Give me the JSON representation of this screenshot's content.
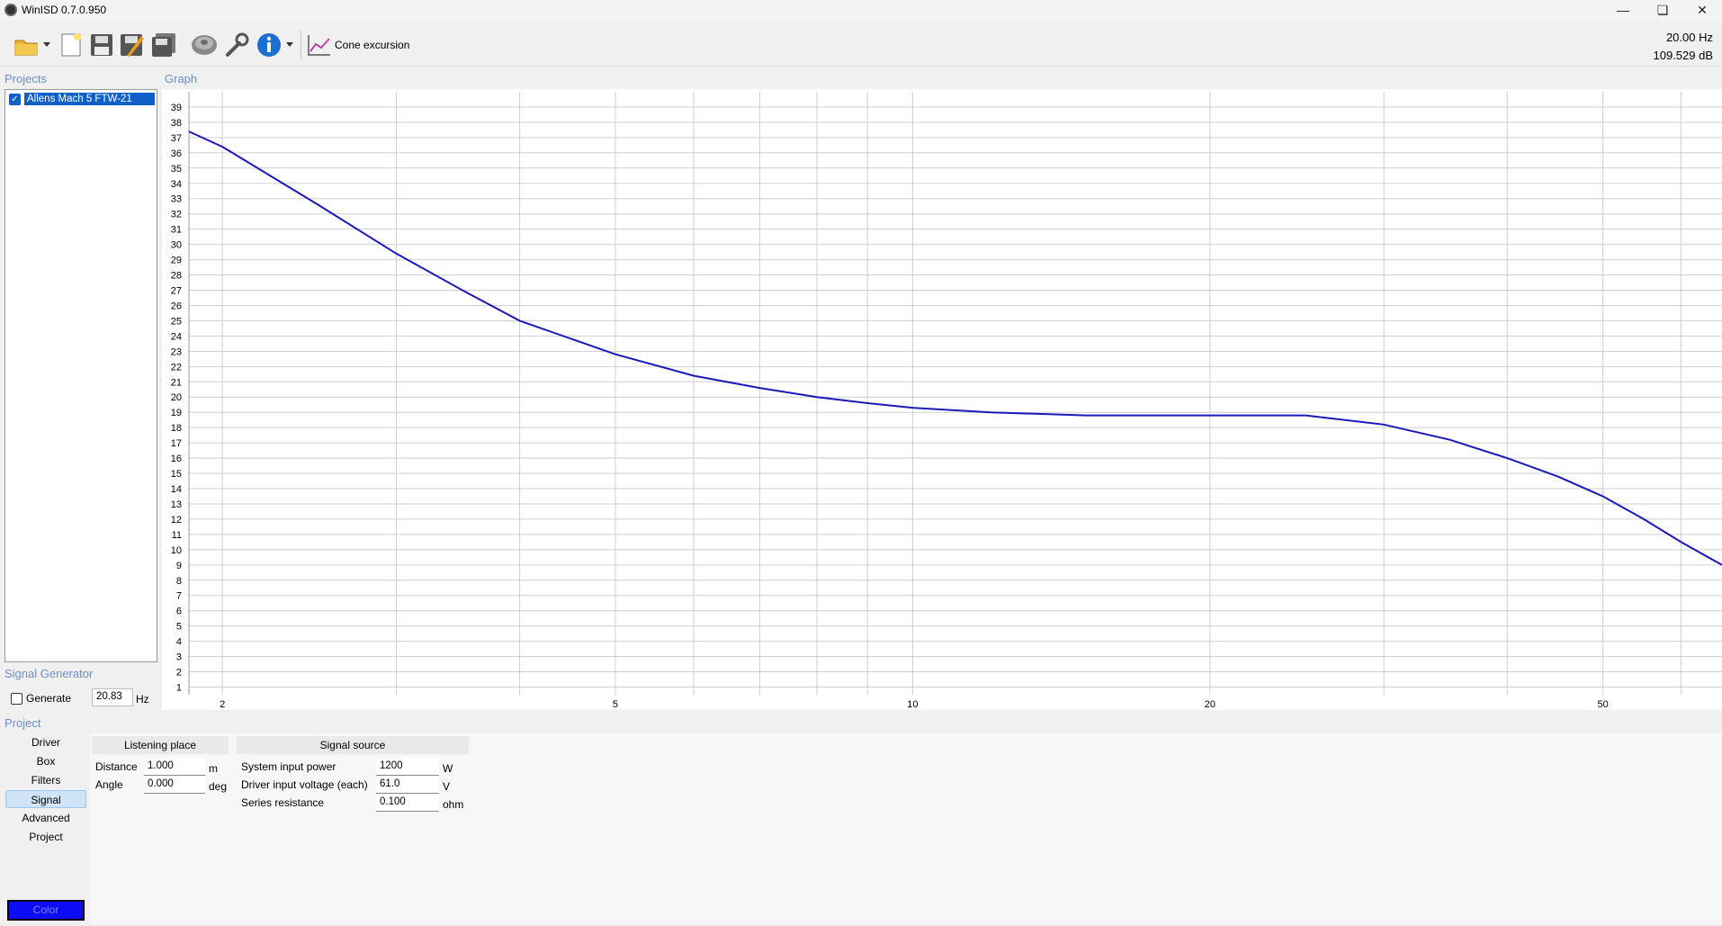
{
  "window": {
    "title": "WinISD 0.7.0.950"
  },
  "toolbar": {
    "graph_selector_label": "Cone excursion"
  },
  "readout": {
    "frequency": "20.00 Hz",
    "level": "109.529 dB"
  },
  "sections": {
    "projects": "Projects",
    "graph": "Graph",
    "signal_generator": "Signal Generator",
    "project": "Project"
  },
  "projects": [
    {
      "name": "Allens Mach 5 FTW-21",
      "checked": true
    }
  ],
  "signal_generator": {
    "generate_label": "Generate",
    "generate_checked": false,
    "frequency": "20.83",
    "unit": "Hz"
  },
  "nav": {
    "items": [
      "Driver",
      "Box",
      "Filters",
      "Signal",
      "Advanced",
      "Project"
    ],
    "active": "Signal",
    "color_button": "Color"
  },
  "listening_place": {
    "title": "Listening place",
    "distance_label": "Distance",
    "distance_value": "1.000",
    "distance_unit": "m",
    "angle_label": "Angle",
    "angle_value": "0.000",
    "angle_unit": "deg"
  },
  "signal_source": {
    "title": "Signal source",
    "power_label": "System input power",
    "power_value": "1200",
    "power_unit": "W",
    "voltage_label": "Driver input voltage (each)",
    "voltage_value": "61.0",
    "voltage_unit": "V",
    "resistance_label": "Series resistance",
    "resistance_value": "0.100",
    "resistance_unit": "ohm"
  },
  "colors": {
    "accent": "#0f60c8",
    "curve": "#1a1ab8",
    "section_label": "#6b8fc8",
    "series_color": "#0c0cf5"
  },
  "chart_data": {
    "type": "line",
    "x_scale": "log",
    "xlim": [
      1.85,
      66
    ],
    "ylim": [
      0.5,
      40
    ],
    "x_ticks": [
      2,
      5,
      10,
      20,
      50
    ],
    "y_ticks": [
      1,
      2,
      3,
      4,
      5,
      6,
      7,
      8,
      9,
      10,
      11,
      12,
      13,
      14,
      15,
      16,
      17,
      18,
      19,
      20,
      21,
      22,
      23,
      24,
      25,
      26,
      27,
      28,
      29,
      30,
      31,
      32,
      33,
      34,
      35,
      36,
      37,
      38,
      39
    ],
    "grid": true,
    "series": [
      {
        "x": [
          1.85,
          2,
          2.5,
          3,
          3.5,
          4,
          5,
          6,
          7,
          8,
          9,
          10,
          12,
          15,
          20,
          25,
          30,
          35,
          40,
          45,
          50,
          55,
          60,
          66
        ],
        "y": [
          37.4,
          36.4,
          32.6,
          29.4,
          27.0,
          25.0,
          22.8,
          21.4,
          20.6,
          20.0,
          19.6,
          19.3,
          19.0,
          18.8,
          18.8,
          18.8,
          18.2,
          17.2,
          16.0,
          14.8,
          13.5,
          12.0,
          10.5,
          9.0
        ]
      }
    ]
  }
}
